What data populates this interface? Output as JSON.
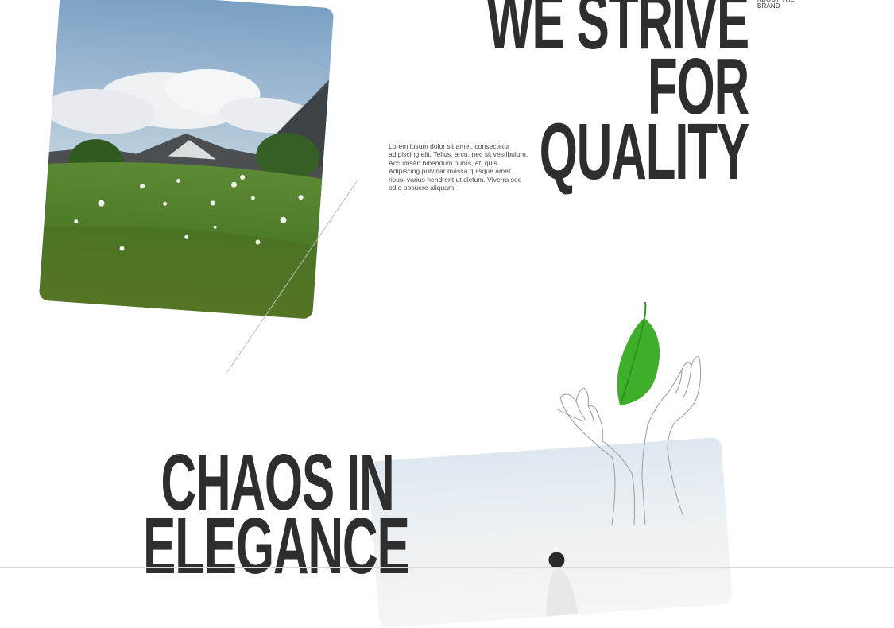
{
  "header": {
    "about_label": "ABOUT THE BRAND"
  },
  "hero": {
    "headline_lines": [
      "WE STRIVE",
      "FOR",
      "QUALITY"
    ],
    "paragraph": "Lorem ipsum dolor sit amet, consectetur adipiscing elit. Tellus, arcu, nec sit vestibulum. Accumsan bibendum purus, et, quis. Adipiscing pulvinar massa quisque amet risus, varius hendrerit ut dictum. Viverra sed odio posuere aliquam."
  },
  "section2": {
    "headline_lines": [
      "CHAOS IN",
      "ELEGANCE"
    ]
  },
  "colors": {
    "text": "#2e2e2e",
    "leaf_green": "#3fae2a",
    "line_gray": "#bdbdbd"
  }
}
